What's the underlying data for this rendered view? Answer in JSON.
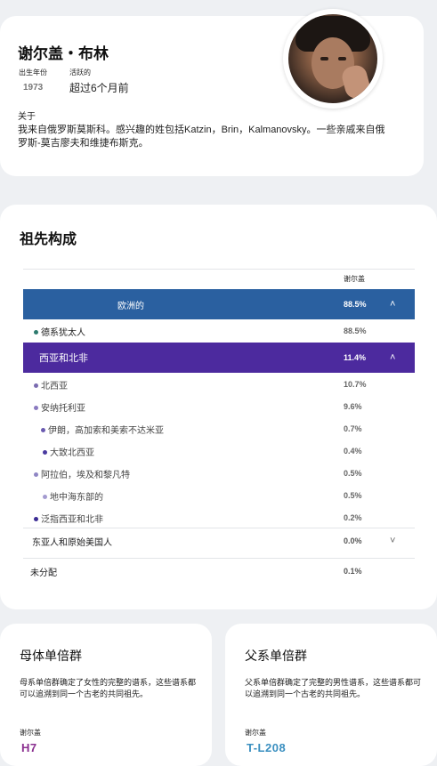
{
  "profile": {
    "name": "谢尔盖・布林",
    "born_label": "出生年份",
    "born_value": "1973",
    "active_label": "活跃的",
    "active_value": "超过6个月前",
    "about_label": "关于",
    "about_text": "我来自俄罗斯莫斯科。感兴趣的姓包括Katzin，Brin，Kalmanovsky。一些亲戚来自俄罗斯-莫吉廖夫和维捷布斯克。"
  },
  "ancestry": {
    "title": "祖先构成",
    "column_header": "谢尔盖",
    "europe": {
      "label": "欧洲的",
      "pct": "88.5%",
      "color": "#2a60a0"
    },
    "ashkenazi": {
      "label": "德系犹太人",
      "pct": "88.5%",
      "dot": "#2d7a6e"
    },
    "mena": {
      "label": "西亚和北非",
      "pct": "11.4%",
      "color": "#4c2a9e"
    },
    "sub_rows": [
      {
        "label": "北西亚",
        "pct": "10.7%",
        "dot": "#7a6bb0"
      },
      {
        "label": "安纳托利亚",
        "pct": "9.6%",
        "dot": "#8a7ac0"
      },
      {
        "label": "伊朗，高加索和美索不达米亚",
        "pct": "0.7%",
        "dot": "#6a5ab0"
      },
      {
        "label": "大致北西亚",
        "pct": "0.4%",
        "dot": "#4a3aa0"
      },
      {
        "label": "阿拉伯，埃及和黎凡特",
        "pct": "0.5%",
        "dot": "#8f86c4"
      },
      {
        "label": "地中海东部的",
        "pct": "0.5%",
        "dot": "#a49bd0"
      },
      {
        "label": "泛指西亚和北非",
        "pct": "0.2%",
        "dot": "#3b2c94"
      }
    ],
    "east_asian": {
      "label": "东亚人和原始美国人",
      "pct": "0.0%"
    },
    "unassigned": {
      "label": "未分配",
      "pct": "0.1%"
    }
  },
  "maternal": {
    "title": "母体单倍群",
    "description": "母系单倍群确定了女性的完整的谱系，这些谱系都可以追溯到同一个古老的共同祖先。",
    "name_label": "谢尔盖",
    "value": "H7",
    "color": "#8a2e8f"
  },
  "paternal": {
    "title": "父系单倍群",
    "description": "父系单倍群确定了完整的男性谱系，这些谱系都可以追溯到同一个古老的共同祖先。",
    "name_label": "谢尔盖",
    "value": "T-L208",
    "color": "#3a8fc0"
  },
  "icons": {
    "chevron_up": "chevron-up-icon",
    "chevron_down": "chevron-down-icon"
  }
}
